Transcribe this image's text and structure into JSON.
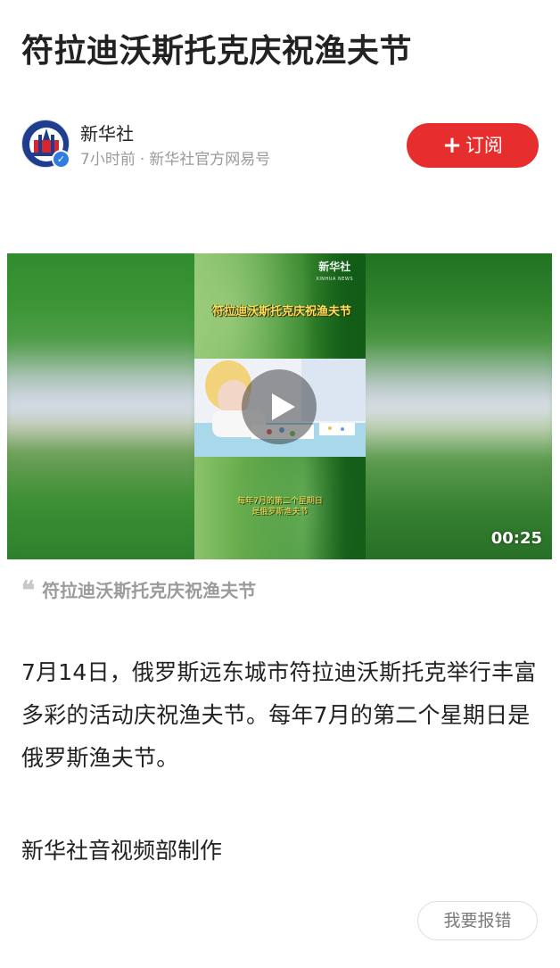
{
  "article": {
    "title": "符拉迪沃斯托克庆祝渔夫节",
    "paragraph": "7月14日，俄罗斯远东城市符拉迪沃斯托克举行丰富多彩的活动庆祝渔夫节。每年7月的第二个星期日是俄罗斯渔夫节。",
    "credit": "新华社音视频部制作"
  },
  "author": {
    "name": "新华社",
    "time": "7小时前",
    "separator": "·",
    "source": "新华社官方网易号",
    "verified_icon": "check-badge-icon",
    "avatar_label": "新华社"
  },
  "subscribe": {
    "icon": "plus-icon",
    "label": "订阅",
    "color": "#e62e2e"
  },
  "video": {
    "logo": "新华社",
    "logo_sub": "XINHUA NEWS",
    "overlay_title": "符拉迪沃斯托克庆祝渔夫节",
    "overlay_subtitle_line1": "每年7月的第二个星期日",
    "overlay_subtitle_line2": "是俄罗斯渔夫节",
    "duration": "00:25",
    "play_icon": "play-icon"
  },
  "caption": {
    "quote_icon": "quote-icon",
    "quote_mark": "❝",
    "text": "符拉迪沃斯托克庆祝渔夫节"
  },
  "report": {
    "label": "我要报错"
  }
}
